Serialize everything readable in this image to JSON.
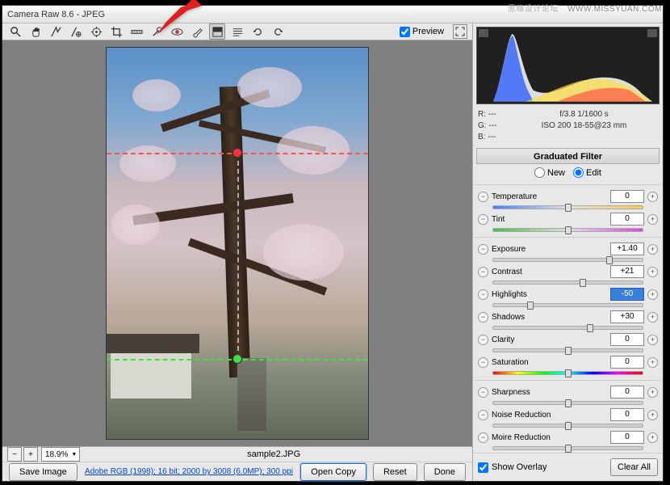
{
  "title": "Camera Raw 8.6  -  JPEG",
  "watermark": {
    "cn": "思缘设计论坛",
    "en": "WWW.MISSYUAN.COM"
  },
  "preview_label": "Preview",
  "zoom": "18.9%",
  "filename": "sample2.JPG",
  "meta": "Adobe RGB (1998); 16 bit; 2000 by 3008 (6.0MP); 300 ppi",
  "buttons": {
    "save": "Save Image",
    "open": "Open Copy",
    "reset": "Reset",
    "done": "Done",
    "clear": "Clear All"
  },
  "info": {
    "r": "R:    ---",
    "g": "G:    ---",
    "b": "B:    ---",
    "aperture_shutter": "f/3.8   1/1600 s",
    "iso_lens": "ISO 200    18-55@23 mm"
  },
  "panel_title": "Graduated Filter",
  "radio": {
    "new": "New",
    "edit": "Edit"
  },
  "show_overlay": "Show Overlay",
  "sliders": {
    "temperature": {
      "label": "Temperature",
      "value": "0",
      "pos": 50
    },
    "tint": {
      "label": "Tint",
      "value": "0",
      "pos": 50
    },
    "exposure": {
      "label": "Exposure",
      "value": "+1.40",
      "pos": 78
    },
    "contrast": {
      "label": "Contrast",
      "value": "+21",
      "pos": 60
    },
    "highlights": {
      "label": "Highlights",
      "value": "-50",
      "pos": 25
    },
    "shadows": {
      "label": "Shadows",
      "value": "+30",
      "pos": 65
    },
    "clarity": {
      "label": "Clarity",
      "value": "0",
      "pos": 50
    },
    "saturation": {
      "label": "Saturation",
      "value": "0",
      "pos": 50
    },
    "sharpness": {
      "label": "Sharpness",
      "value": "0",
      "pos": 50
    },
    "noise": {
      "label": "Noise Reduction",
      "value": "0",
      "pos": 50
    },
    "moire": {
      "label": "Moire Reduction",
      "value": "0",
      "pos": 50
    }
  }
}
